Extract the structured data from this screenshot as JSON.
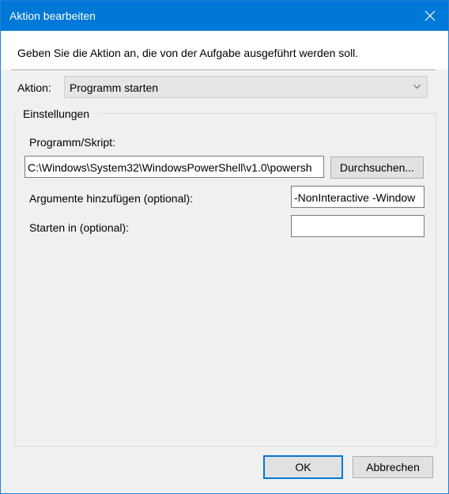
{
  "window": {
    "title": "Aktion bearbeiten",
    "close_icon": "close-icon"
  },
  "instruction": "Geben Sie die Aktion an, die von der Aufgabe ausgeführt werden soll.",
  "action": {
    "label": "Aktion:",
    "selected": "Programm starten",
    "dropdown_icon": "chevron-down-icon"
  },
  "settings": {
    "group_title": "Einstellungen",
    "program_label": "Programm/Skript:",
    "program_value": "C:\\Windows\\System32\\WindowsPowerShell\\v1.0\\powersh",
    "browse_label": "Durchsuchen...",
    "arguments_label": "Argumente hinzufügen (optional):",
    "arguments_value": "-NonInteractive -Window",
    "start_in_label": "Starten in (optional):",
    "start_in_value": ""
  },
  "buttons": {
    "ok": "OK",
    "cancel": "Abbrechen"
  },
  "colors": {
    "titlebar": "#0078d7",
    "dialog_background": "#f0f0f0",
    "default_button_border": "#0078d7"
  }
}
